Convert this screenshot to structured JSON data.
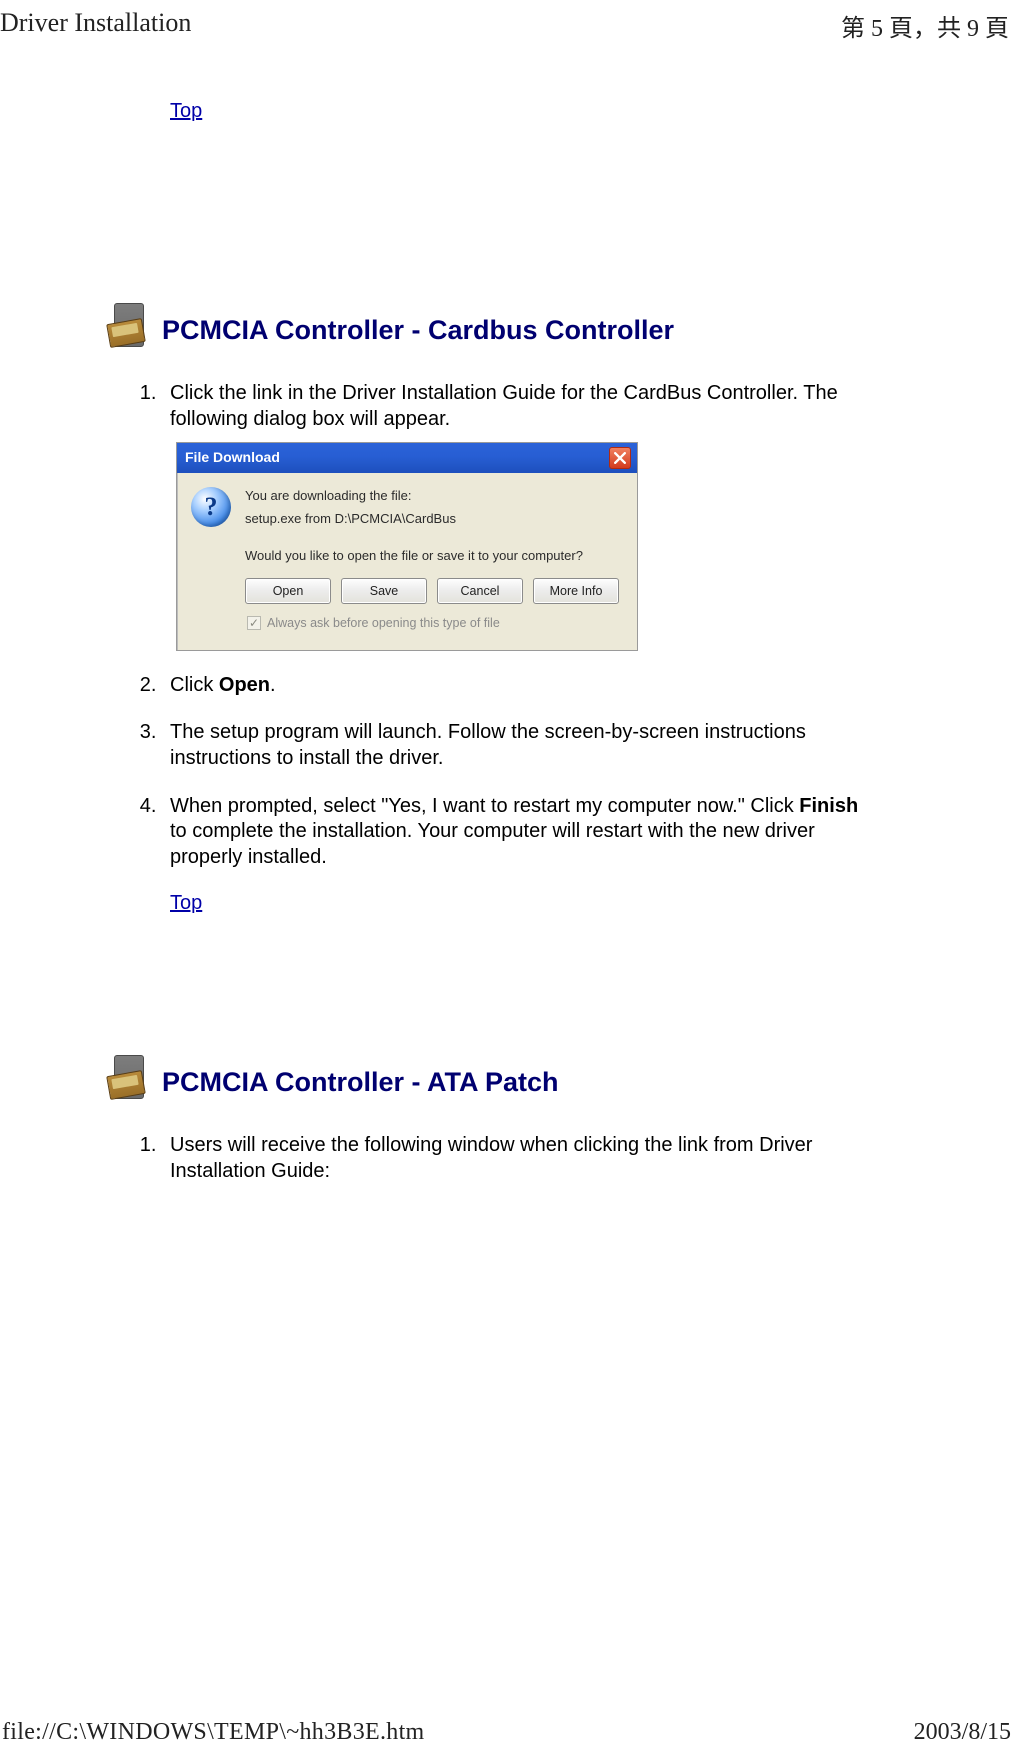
{
  "header": {
    "left": "Driver Installation",
    "right": "第 5 頁，共 9 頁"
  },
  "footer": {
    "left": "file://C:\\WINDOWS\\TEMP\\~hh3B3E.htm",
    "right": "2003/8/15"
  },
  "links": {
    "top": "Top"
  },
  "section1": {
    "title": "PCMCIA Controller - Cardbus Controller",
    "steps": {
      "s1": "Click the link in the Driver Installation Guide for the CardBus Controller. The following dialog box will appear.",
      "s2_pre": "Click ",
      "s2_bold": "Open",
      "s2_post": ".",
      "s3": "The setup program will launch. Follow the screen-by-screen instructions instructions to install the driver.",
      "s4_pre": "When prompted, select \"Yes, I want to restart my computer now.\" Click ",
      "s4_bold": "Finish",
      "s4_post": " to complete the installation. Your computer will restart with the new driver properly installed."
    }
  },
  "section2": {
    "title": "PCMCIA Controller - ATA Patch",
    "steps": {
      "s1": "Users will receive the following window when clicking the link from Driver Installation Guide:"
    }
  },
  "dialog": {
    "title": "File Download",
    "line1": "You are downloading the file:",
    "line2": "setup.exe from D:\\PCMCIA\\CardBus",
    "line3": "Would you like to open the file or save it to your computer?",
    "buttons": {
      "open": "Open",
      "save": "Save",
      "cancel": "Cancel",
      "more": "More Info"
    },
    "checkbox": "Always ask before opening this type of file",
    "checked": "✓"
  }
}
